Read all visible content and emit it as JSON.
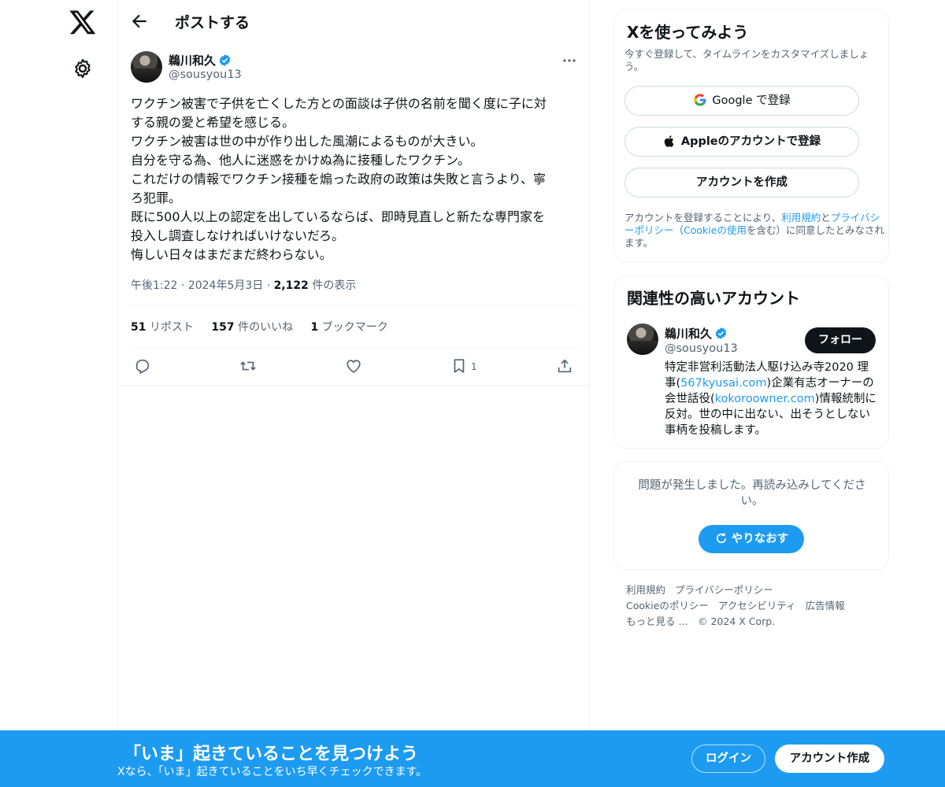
{
  "header": {
    "title": "ポストする"
  },
  "post": {
    "author_name": "鵜川和久",
    "handle": "@sousyou13",
    "lines": [
      "ワクチン被害で子供を亡くした方との面談は子供の名前を聞く度に子に対",
      "する親の愛と希望を感じる。",
      "ワクチン被害は世の中が作り出した風潮によるものが大きい。",
      "自分を守る為、他人に迷惑をかけぬ為に接種したワクチン。",
      "これだけの情報でワクチン接種を煽った政府の政策は失敗と言うより、寧",
      "ろ犯罪。",
      "既に500人以上の認定を出しているならば、即時見直しと新たな専門家を",
      "投入し調査しなければいけないだろ。",
      "悔しい日々はまだまだ終わらない。"
    ],
    "time": "午後1:22",
    "sep": "·",
    "date": "2024年5月3日",
    "views_count": "2,122",
    "views_label": "件の表示",
    "reposts_count": "51",
    "reposts_label": "リポスト",
    "likes_count": "157",
    "likes_label": "件のいいね",
    "bookmarks_count": "1",
    "bookmarks_label": "ブックマーク",
    "bookmark_action_count": "1"
  },
  "signup": {
    "title": "Xを使ってみよう",
    "subtitle": "今すぐ登録して、タイムラインをカスタマイズしましょう。",
    "google_label": "Google で登録",
    "apple_label": "Appleのアカウントで登録",
    "create_label": "アカウントを作成",
    "legal_1": "アカウントを登録することにより、",
    "legal_terms": "利用規約",
    "legal_2": "と",
    "legal_privacy": "プライバシーポリシー",
    "legal_3": "（",
    "legal_cookie": "Cookieの使用",
    "legal_4": "を含む）に同意したとみなされます。"
  },
  "relevant": {
    "title": "関連性の高いアカウント",
    "name": "鵜川和久",
    "handle": "@sousyou13",
    "follow_label": "フォロー",
    "bio_1": "特定非営利活動法人駆け込み寺2020 理事(",
    "bio_link1": "567kyusai.com",
    "bio_2": ")企業有志オーナーの会世話役(",
    "bio_link2": "kokoroowner.com",
    "bio_3": ")情報統制に反対。世の中に出ない、出そうとしない事柄を投稿します。"
  },
  "error": {
    "message": "問題が発生しました。再読み込みしてください。",
    "retry_label": "やりなおす"
  },
  "footer": {
    "links": [
      "利用規約",
      "プライバシーポリシー",
      "Cookieのポリシー",
      "アクセシビリティ",
      "広告情報",
      "もっと見る …",
      "© 2024 X Corp."
    ]
  },
  "bottom_bar": {
    "title": "「いま」起きていることを見つけよう",
    "subtitle": "Xなら、「いま」起きていることをいち早くチェックできます。",
    "login_label": "ログイン",
    "create_label": "アカウント作成"
  },
  "colors": {
    "accent": "#1d9bf0",
    "text": "#0f1419",
    "muted": "#536471",
    "border": "#eff3f4"
  },
  "icons": [
    "x-logo-icon",
    "gear-icon",
    "back-arrow-icon",
    "verified-badge-icon",
    "more-icon",
    "reply-icon",
    "repost-icon",
    "like-icon",
    "bookmark-icon",
    "share-icon",
    "google-icon",
    "apple-icon",
    "refresh-icon"
  ]
}
